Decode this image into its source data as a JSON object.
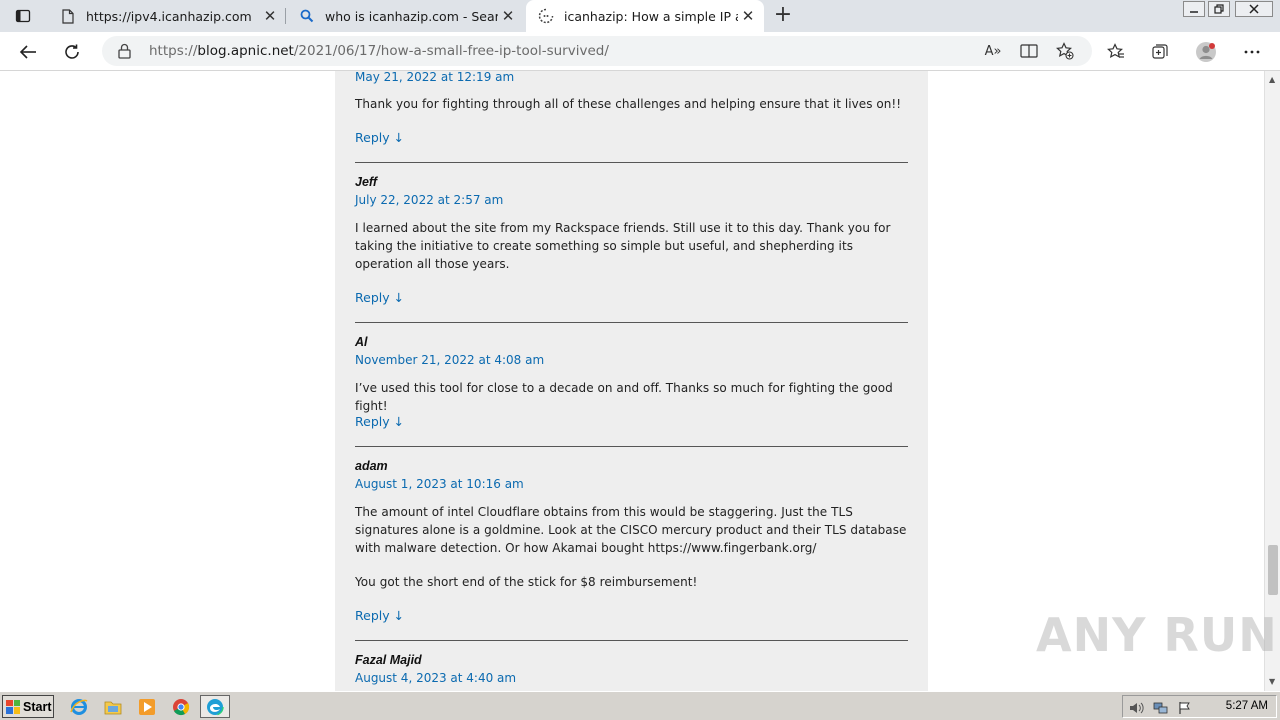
{
  "browser": {
    "tabs": [
      {
        "title": "https://ipv4.icanhazip.com",
        "icon": "page-icon",
        "active": false
      },
      {
        "title": "who is icanhazip.com - Search",
        "icon": "search-icon",
        "active": false
      },
      {
        "title": "icanhazip: How a simple IP addre",
        "icon": "loading-icon",
        "active": true
      }
    ],
    "address": {
      "prefix": "https://",
      "host": "blog.apnic.net",
      "path": "/2021/06/17/how-a-small-free-ip-tool-survived/"
    },
    "read_aloud_glyph": "A»"
  },
  "comments": [
    {
      "author": "",
      "date": "May 21, 2022 at 12:19 am",
      "paragraphs": [
        "Thank you for fighting through all of these challenges and helping ensure that it lives on!!"
      ],
      "reply": "Reply ↓"
    },
    {
      "author": "Jeff",
      "date": "July 22, 2022 at 2:57 am",
      "paragraphs": [
        "I learned about the site from my Rackspace friends. Still use it to this day. Thank you for taking the initiative to create something so simple but useful, and shepherding its operation all those years."
      ],
      "reply": "Reply ↓"
    },
    {
      "author": "Al",
      "date": "November 21, 2022 at 4:08 am",
      "paragraphs": [
        "I’ve used this tool for close to a decade on and off. Thanks so much for fighting the good fight!"
      ],
      "reply": "Reply ↓"
    },
    {
      "author": "adam",
      "date": "August 1, 2023 at 10:16 am",
      "paragraphs": [
        "The amount of intel Cloudflare obtains from this would be staggering. Just the TLS signatures alone is a goldmine. Look at the CISCO mercury product and their TLS database with malware detection. Or how Akamai bought https://www.fingerbank.org/",
        "You got the short end of the stick for $8 reimbursement!"
      ],
      "reply": "Reply ↓"
    },
    {
      "author": "Fazal Majid",
      "date": "August 4, 2023 at 4:40 am",
      "paragraphs": [],
      "reply": ""
    }
  ],
  "watermark": "ANY RUN",
  "taskbar": {
    "start_label": "Start",
    "clock": "5:27 AM",
    "apps": [
      "ie-icon",
      "explorer-icon",
      "media-player-icon",
      "chrome-icon",
      "edge-icon"
    ]
  },
  "colors": {
    "link": "#0b6ab0",
    "column_bg": "#eeeeee",
    "tabstrip_bg": "#dfe3e8"
  }
}
